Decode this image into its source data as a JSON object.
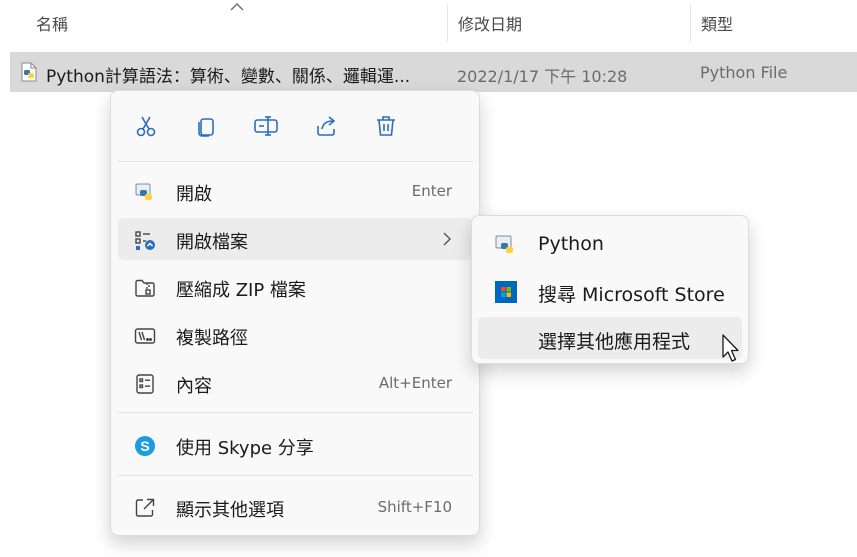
{
  "columns": {
    "name": "名稱",
    "date_modified": "修改日期",
    "type": "類型"
  },
  "file": {
    "name": "Python計算語法：算術、變數、關係、邏輯運...",
    "date": "2022/1/17 下午 10:28",
    "type": "Python File"
  },
  "toolbar": [
    "cut-icon",
    "copy-icon",
    "rename-icon",
    "share-icon",
    "delete-icon"
  ],
  "menu": {
    "open": {
      "label": "開啟",
      "shortcut": "Enter"
    },
    "open_with": {
      "label": "開啟檔案"
    },
    "compress": {
      "label": "壓縮成 ZIP 檔案"
    },
    "copy_path": {
      "label": "複製路徑"
    },
    "properties": {
      "label": "內容",
      "shortcut": "Alt+Enter"
    },
    "skype": {
      "label": "使用 Skype 分享"
    },
    "more": {
      "label": "顯示其他選項",
      "shortcut": "Shift+F10"
    }
  },
  "submenu": {
    "python": "Python",
    "store": "搜尋 Microsoft Store",
    "choose": "選擇其他應用程式"
  },
  "colors": {
    "selection": "#d9d9d9",
    "accent": "#0067c0",
    "menu_bg": "#f9f9f9"
  }
}
